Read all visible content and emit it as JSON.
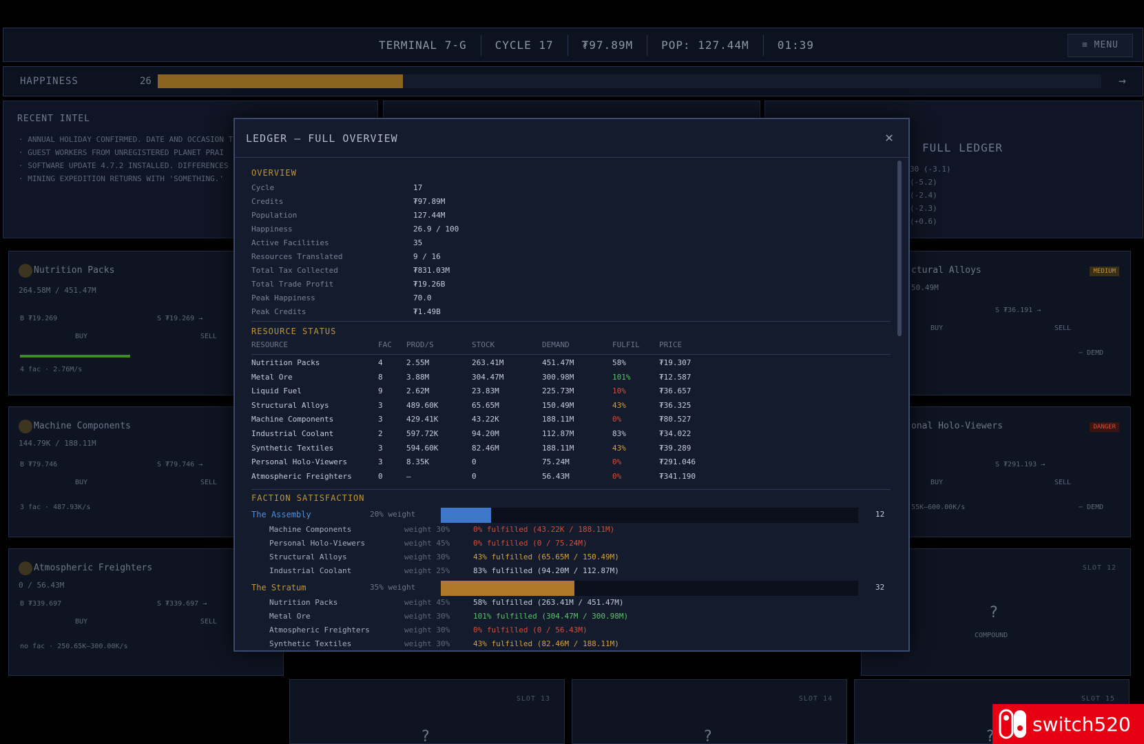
{
  "topbar": {
    "terminal": "TERMINAL 7-G",
    "cycle": "CYCLE 17",
    "credits": "₮97.89M",
    "pop": "POP: 127.44M",
    "time": "01:39",
    "menu": "≡ MENU"
  },
  "happiness": {
    "label": "HAPPINESS",
    "value": "26",
    "fraction": 0.26,
    "arrow": "→"
  },
  "intel": {
    "title": "RECENT INTEL",
    "items": [
      "· ANNUAL HOLIDAY CONFIRMED. DATE AND OCCASION T",
      "· GUEST WORKERS FROM UNREGISTERED PLANET PRAI",
      "· SOFTWARE UPDATE 4.7.2 INSTALLED. DIFFERENCES I",
      "· MINING EXPEDITION RETURNS WITH 'SOMETHING.'"
    ]
  },
  "ledger_panel": {
    "title": "FULL LEDGER",
    "lines": [
      "30 (-3.1)",
      "(-5.2)",
      "(-2.4)",
      "(-2.3)",
      "(+0.6)"
    ]
  },
  "bg_cards": {
    "nutrition": {
      "name": "Nutrition Packs",
      "sub": "264.58M / 451.47M",
      "buy": "B ₮19.269",
      "sell": "S ₮19.269 →",
      "buy_lbl": "BUY",
      "sell_lbl": "SELL",
      "foot": "4 fac · 2.76M/s"
    },
    "machine": {
      "name": "Machine Components",
      "sub": "144.79K / 188.11M",
      "buy": "B ₮79.746",
      "sell": "S ₮79.746 →",
      "buy_lbl": "BUY",
      "sell_lbl": "SELL",
      "foot": "3 fac · 487.93K/s"
    },
    "atmos": {
      "name": "Atmospheric Freighters",
      "sub": "0 / 56.43M",
      "buy": "B ₮339.697",
      "sell": "S ₮339.697 →",
      "buy_lbl": "BUY",
      "sell_lbl": "SELL",
      "foot": "no fac · 250.65K–300.00K/s"
    },
    "structural": {
      "name": "ctural Alloys",
      "badge": "MEDIUM",
      "sub": "50.49M",
      "sell": "S ₮36.191 →",
      "buy_lbl": "BUY",
      "sell_lbl": "SELL",
      "demand": "− DEMD"
    },
    "holo": {
      "name": "onal Holo-Viewers",
      "badge": "DANGER",
      "sell": "S ₮291.193 →",
      "buy_lbl": "BUY",
      "sell_lbl": "SELL",
      "foot": "55K–600.00K/s",
      "demand": "− DEMD"
    },
    "compound": {
      "slot": "SLOT 12",
      "q": "?",
      "label": "COMPOUND"
    },
    "slot13": {
      "slot": "SLOT 13",
      "q": "?"
    },
    "slot14": {
      "slot": "SLOT 14",
      "q": "?"
    },
    "slot15": {
      "slot": "SLOT 15",
      "q": "?"
    }
  },
  "modal": {
    "title": "LEDGER — FULL OVERVIEW",
    "close": "✕",
    "overview_title": "OVERVIEW",
    "overview": [
      {
        "k": "Cycle",
        "v": "17"
      },
      {
        "k": "Credits",
        "v": "₮97.89M"
      },
      {
        "k": "Population",
        "v": "127.44M"
      },
      {
        "k": "Happiness",
        "v": "26.9 / 100"
      },
      {
        "k": "Active Facilities",
        "v": "35"
      },
      {
        "k": "Resources Translated",
        "v": "9 / 16"
      },
      {
        "k": "Total Tax Collected",
        "v": "₮831.03M"
      },
      {
        "k": "Total Trade Profit",
        "v": "₮19.26B"
      },
      {
        "k": "Peak Happiness",
        "v": "70.0"
      },
      {
        "k": "Peak Credits",
        "v": "₮1.49B"
      }
    ],
    "resource_title": "RESOURCE STATUS",
    "resource_headers": [
      "RESOURCE",
      "FAC",
      "PROD/S",
      "STOCK",
      "DEMAND",
      "FULFIL",
      "PRICE"
    ],
    "resources": [
      {
        "name": "Nutrition Packs",
        "fac": "4",
        "prod": "2.55M",
        "stock": "263.41M",
        "demand": "451.47M",
        "fulfil": "58%",
        "color": "#c5ccda",
        "price": "₮19.307"
      },
      {
        "name": "Metal Ore",
        "fac": "8",
        "prod": "3.88M",
        "stock": "304.47M",
        "demand": "300.98M",
        "fulfil": "101%",
        "color": "#5cc46a",
        "price": "₮12.587"
      },
      {
        "name": "Liquid Fuel",
        "fac": "9",
        "prod": "2.62M",
        "stock": "23.83M",
        "demand": "225.73M",
        "fulfil": "10%",
        "color": "#d2503c",
        "price": "₮36.657"
      },
      {
        "name": "Structural Alloys",
        "fac": "3",
        "prod": "489.60K",
        "stock": "65.65M",
        "demand": "150.49M",
        "fulfil": "43%",
        "color": "#d6a23a",
        "price": "₮36.325"
      },
      {
        "name": "Machine Components",
        "fac": "3",
        "prod": "429.41K",
        "stock": "43.22K",
        "demand": "188.11M",
        "fulfil": "0%",
        "color": "#d2503c",
        "price": "₮80.527"
      },
      {
        "name": "Industrial Coolant",
        "fac": "2",
        "prod": "597.72K",
        "stock": "94.20M",
        "demand": "112.87M",
        "fulfil": "83%",
        "color": "#c5ccda",
        "price": "₮34.022"
      },
      {
        "name": "Synthetic Textiles",
        "fac": "3",
        "prod": "594.60K",
        "stock": "82.46M",
        "demand": "188.11M",
        "fulfil": "43%",
        "color": "#d6a23a",
        "price": "₮39.289"
      },
      {
        "name": "Personal Holo-Viewers",
        "fac": "3",
        "prod": "8.35K",
        "stock": "0",
        "demand": "75.24M",
        "fulfil": "0%",
        "color": "#d2503c",
        "price": "₮291.046"
      },
      {
        "name": "Atmospheric Freighters",
        "fac": "0",
        "prod": "—",
        "stock": "0",
        "demand": "56.43M",
        "fulfil": "0%",
        "color": "#d2503c",
        "price": "₮341.190"
      }
    ],
    "faction_title": "FACTION SATISFACTION",
    "factions": [
      {
        "name": "The Assembly",
        "name_color": "#4f8fd6",
        "weight": "20% weight",
        "value": "12",
        "fraction": 0.12,
        "bar_color": "#3f78c8",
        "rows": [
          {
            "res": "Machine Components",
            "weight": "weight 30%",
            "text": "0% fulfilled  (43.22K / 188.11M)",
            "color": "#d2503c"
          },
          {
            "res": "Personal Holo-Viewers",
            "weight": "weight 45%",
            "text": "0% fulfilled  (0 / 75.24M)",
            "color": "#d2503c"
          },
          {
            "res": "Structural Alloys",
            "weight": "weight 30%",
            "text": "43% fulfilled  (65.65M / 150.49M)",
            "color": "#d6a23a"
          },
          {
            "res": "Industrial Coolant",
            "weight": "weight 25%",
            "text": "83% fulfilled  (94.20M / 112.87M)",
            "color": "#c5ccda"
          }
        ]
      },
      {
        "name": "The Stratum",
        "name_color": "#c0963a",
        "weight": "35% weight",
        "value": "32",
        "fraction": 0.32,
        "bar_color": "#b0782a",
        "rows": [
          {
            "res": "Nutrition Packs",
            "weight": "weight 45%",
            "text": "58% fulfilled  (263.41M / 451.47M)",
            "color": "#c5ccda"
          },
          {
            "res": "Metal Ore",
            "weight": "weight 30%",
            "text": "101% fulfilled  (304.47M / 300.98M)",
            "color": "#5cc46a"
          },
          {
            "res": "Atmospheric Freighters",
            "weight": "weight 30%",
            "text": "0% fulfilled  (0 / 56.43M)",
            "color": "#d2503c"
          },
          {
            "res": "Synthetic Textiles",
            "weight": "weight 30%",
            "text": "43% fulfilled  (82.46M / 188.11M)",
            "color": "#d6a23a"
          }
        ]
      }
    ]
  },
  "watermark": {
    "text": "switch520"
  }
}
